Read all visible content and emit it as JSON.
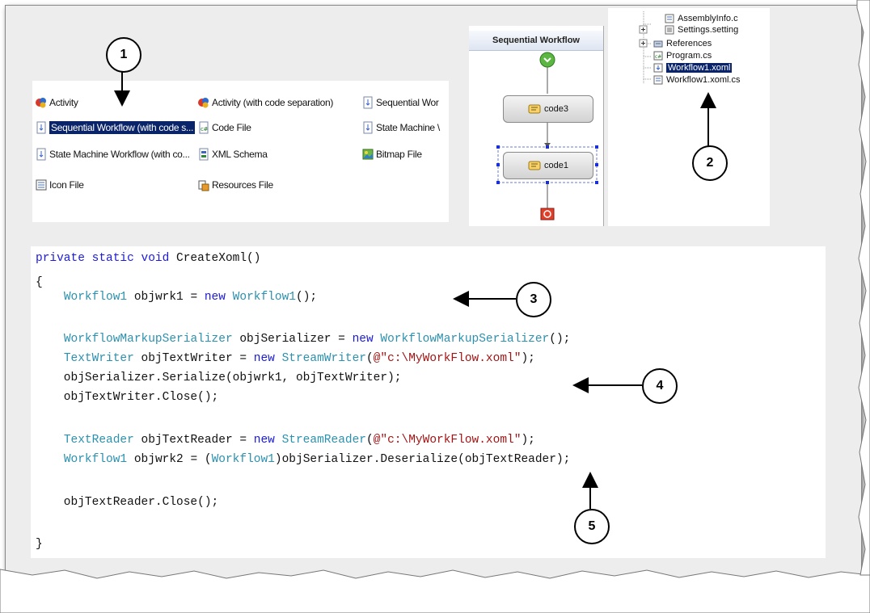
{
  "templates": {
    "items": [
      {
        "label": "Activity",
        "icon": "activity-icon"
      },
      {
        "label": "Activity (with code separation)",
        "icon": "activity-icon"
      },
      {
        "label": "Sequential Wor",
        "icon": "workflow-icon"
      },
      {
        "label": "Sequential Workflow (with code s...",
        "icon": "workflow-icon",
        "selected": true
      },
      {
        "label": "Code File",
        "icon": "code-file-icon"
      },
      {
        "label": "State Machine \\",
        "icon": "workflow-icon"
      },
      {
        "label": "State Machine Workflow (with co...",
        "icon": "workflow-icon"
      },
      {
        "label": "XML Schema",
        "icon": "xml-schema-icon"
      },
      {
        "label": "Bitmap File",
        "icon": "bitmap-icon"
      },
      {
        "label": "Icon File",
        "icon": "icon-file-icon"
      },
      {
        "label": "Resources File",
        "icon": "resources-icon"
      }
    ]
  },
  "designer": {
    "title": "Sequential Workflow",
    "activities": [
      "code3",
      "code1"
    ]
  },
  "solution": {
    "items": [
      {
        "label": "AssemblyInfo.c",
        "icon": "cs-file-icon"
      },
      {
        "label": "Settings.setting",
        "icon": "settings-icon"
      },
      {
        "label": "References",
        "icon": "references-icon"
      },
      {
        "label": "Program.cs",
        "icon": "cs-file-icon"
      },
      {
        "label": "Workflow1.xoml",
        "icon": "xoml-file-icon",
        "selected": true
      },
      {
        "label": "Workflow1.xoml.cs",
        "icon": "cs-file-icon"
      }
    ]
  },
  "code": {
    "lines": [
      [
        {
          "t": "private static void ",
          "c": "kw"
        },
        {
          "t": "CreateXoml()",
          "c": ""
        }
      ],
      [
        {
          "t": "{",
          "c": ""
        }
      ],
      [
        {
          "t": "    ",
          "c": ""
        },
        {
          "t": "Workflow1",
          "c": "ty"
        },
        {
          "t": " objwrk1 = ",
          "c": ""
        },
        {
          "t": "new",
          "c": "kw"
        },
        {
          "t": " ",
          "c": ""
        },
        {
          "t": "Workflow1",
          "c": "ty"
        },
        {
          "t": "();",
          "c": ""
        }
      ],
      [
        {
          "t": "    ",
          "c": ""
        },
        {
          "t": "WorkflowMarkupSerializer",
          "c": "ty"
        },
        {
          "t": " objSerializer = ",
          "c": ""
        },
        {
          "t": "new",
          "c": "kw"
        },
        {
          "t": " ",
          "c": ""
        },
        {
          "t": "WorkflowMarkupSerializer",
          "c": "ty"
        },
        {
          "t": "();",
          "c": ""
        }
      ],
      [
        {
          "t": "    ",
          "c": ""
        },
        {
          "t": "TextWriter",
          "c": "ty"
        },
        {
          "t": " objTextWriter = ",
          "c": ""
        },
        {
          "t": "new",
          "c": "kw"
        },
        {
          "t": " ",
          "c": ""
        },
        {
          "t": "StreamWriter",
          "c": "ty"
        },
        {
          "t": "(",
          "c": ""
        },
        {
          "t": "@\"c:\\MyWorkFlow.xoml\"",
          "c": "st"
        },
        {
          "t": ");",
          "c": ""
        }
      ],
      [
        {
          "t": "    objSerializer.Serialize(objwrk1, objTextWriter);",
          "c": ""
        }
      ],
      [
        {
          "t": "    objTextWriter.Close();",
          "c": ""
        }
      ],
      [
        {
          "t": "    ",
          "c": ""
        },
        {
          "t": "TextReader",
          "c": "ty"
        },
        {
          "t": " objTextReader = ",
          "c": ""
        },
        {
          "t": "new",
          "c": "kw"
        },
        {
          "t": " ",
          "c": ""
        },
        {
          "t": "StreamReader",
          "c": "ty"
        },
        {
          "t": "(",
          "c": ""
        },
        {
          "t": "@\"c:\\MyWorkFlow.xoml\"",
          "c": "st"
        },
        {
          "t": ");",
          "c": ""
        }
      ],
      [
        {
          "t": "    ",
          "c": ""
        },
        {
          "t": "Workflow1",
          "c": "ty"
        },
        {
          "t": " objwrk2 = (",
          "c": ""
        },
        {
          "t": "Workflow1",
          "c": "ty"
        },
        {
          "t": ")objSerializer.Deserialize(objTextReader);",
          "c": ""
        }
      ],
      [
        {
          "t": "    objTextReader.Close();",
          "c": ""
        }
      ],
      [
        {
          "t": "}",
          "c": ""
        }
      ]
    ]
  },
  "callouts": [
    "1",
    "2",
    "3",
    "4",
    "5"
  ]
}
